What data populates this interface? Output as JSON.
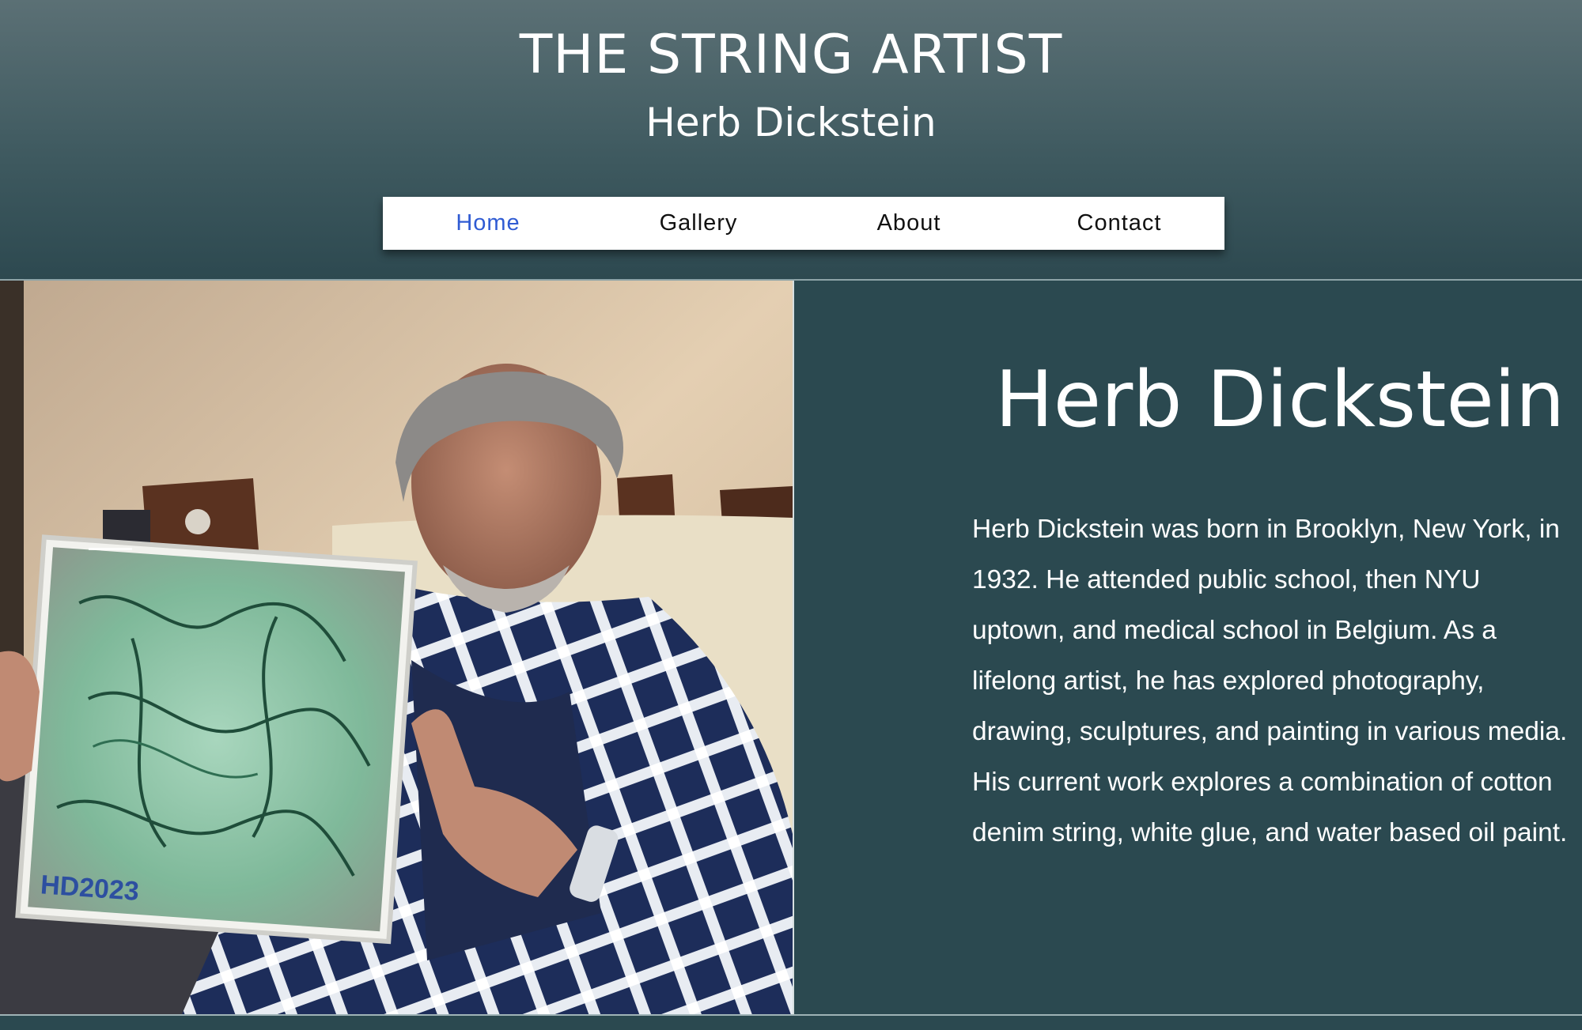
{
  "header": {
    "title": "THE STRING ARTIST",
    "subtitle": "Herb Dickstein"
  },
  "nav": {
    "items": [
      {
        "label": "Home",
        "active": true
      },
      {
        "label": "Gallery",
        "active": false
      },
      {
        "label": "About",
        "active": false
      },
      {
        "label": "Contact",
        "active": false
      }
    ]
  },
  "main": {
    "photo_alt": "Herb Dickstein holding a string artwork",
    "canvas_signature": "HD2023",
    "heading": "Herb Dickstein",
    "bio": "Herb Dickstein was born in Brooklyn, New York, in 1932.  He attended public school, then NYU uptown, and medical school in Belgium. As a lifelong artist, he has explored photography, drawing, sculptures, and painting in various media. His current work explores a combination of cotton denim string, white glue, and water based oil paint."
  },
  "colors": {
    "panel": "#2b4950",
    "nav_active": "#2f5bd3",
    "header_top": "#5b7075"
  }
}
